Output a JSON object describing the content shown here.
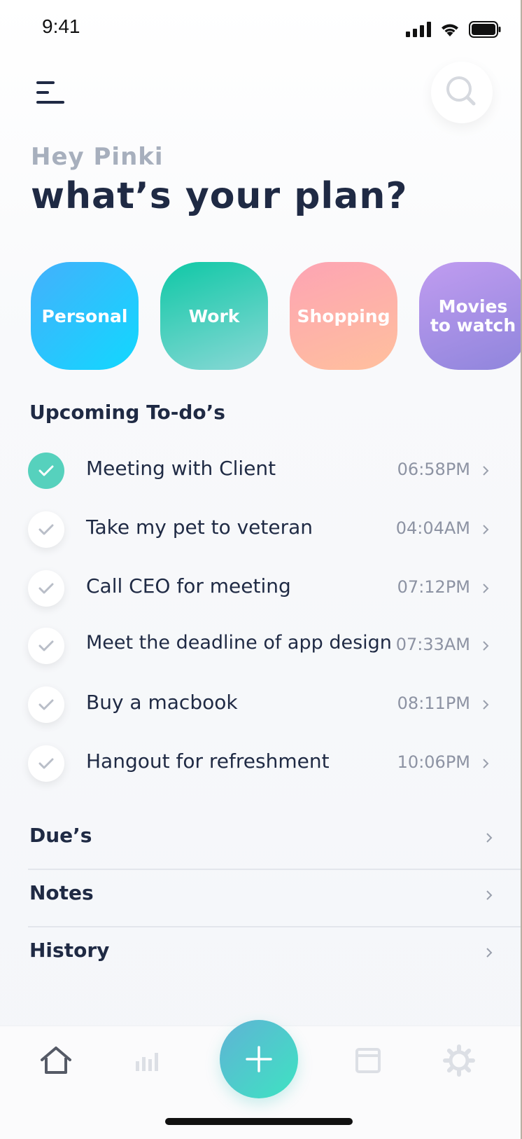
{
  "status_bar": {
    "time": "9:41"
  },
  "header": {
    "greeting": "Hey Pinki",
    "headline": "what’s your plan?"
  },
  "categories": [
    {
      "label": "Personal"
    },
    {
      "label": "Work"
    },
    {
      "label": "Shopping"
    },
    {
      "label_line1": "Movies",
      "label_line2": "to watch"
    }
  ],
  "upcoming": {
    "title": "Upcoming To-do’s",
    "items": [
      {
        "text": "Meeting with Client",
        "time": "06:58PM",
        "done": true
      },
      {
        "text": "Take my pet to veteran",
        "time": "04:04AM",
        "done": false
      },
      {
        "text": "Call CEO for meeting",
        "time": "07:12PM",
        "done": false
      },
      {
        "text": "Meet the deadline of app design",
        "time": "07:33AM",
        "done": false
      },
      {
        "text": "Buy a macbook",
        "time": "08:11PM",
        "done": false
      },
      {
        "text": "Hangout for refreshment",
        "time": "10:06PM",
        "done": false
      }
    ]
  },
  "sections": [
    {
      "label": "Due’s"
    },
    {
      "label": "Notes"
    },
    {
      "label": "History"
    }
  ],
  "tabbar": {
    "items": [
      {
        "icon": "home-icon",
        "active": true
      },
      {
        "icon": "stats-icon",
        "active": false
      },
      {
        "icon": "add-icon"
      },
      {
        "icon": "calendar-icon",
        "active": false
      },
      {
        "icon": "settings-icon",
        "active": false
      }
    ]
  },
  "colors": {
    "accent": "#56d1bd",
    "text_primary": "#1f2a44",
    "text_muted": "#8d93a3"
  }
}
